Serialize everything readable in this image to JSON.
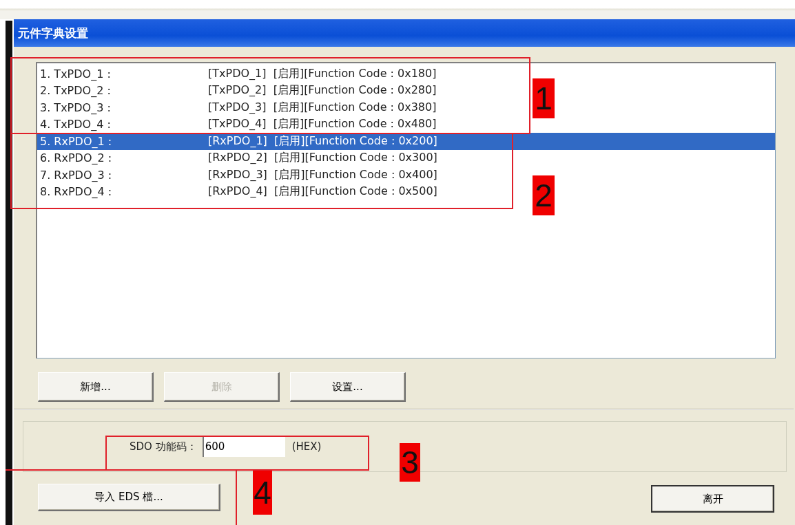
{
  "window": {
    "title": "元件字典设置"
  },
  "list": {
    "rows": [
      {
        "name": "1. TxPDO_1 :",
        "detail": "[TxPDO_1]  [启用][Function Code : 0x180]",
        "selected": false
      },
      {
        "name": "2. TxPDO_2 :",
        "detail": "[TxPDO_2]  [启用][Function Code : 0x280]",
        "selected": false
      },
      {
        "name": "3. TxPDO_3 :",
        "detail": "[TxPDO_3]  [启用][Function Code : 0x380]",
        "selected": false
      },
      {
        "name": "4. TxPDO_4 :",
        "detail": "[TxPDO_4]  [启用][Function Code : 0x480]",
        "selected": false
      },
      {
        "name": "5. RxPDO_1 :",
        "detail": "[RxPDO_1]  [启用][Function Code : 0x200]",
        "selected": true
      },
      {
        "name": "6. RxPDO_2 :",
        "detail": "[RxPDO_2]  [启用][Function Code : 0x300]",
        "selected": false
      },
      {
        "name": "7. RxPDO_3 :",
        "detail": "[RxPDO_3]  [启用][Function Code : 0x400]",
        "selected": false
      },
      {
        "name": "8. RxPDO_4 :",
        "detail": "[RxPDO_4]  [启用][Function Code : 0x500]",
        "selected": false
      }
    ]
  },
  "list_buttons": [
    {
      "label": "新增...",
      "disabled": false
    },
    {
      "label": "删除",
      "disabled": true
    },
    {
      "label": "设置..."
    }
  ],
  "sdo": {
    "label": "SDO 功能码：",
    "value": "600",
    "unit": "(HEX)"
  },
  "footer_buttons": [
    {
      "label": "导入 EDS 檔..."
    },
    {
      "label": "离开"
    }
  ],
  "annotations": [
    "1",
    "2",
    "3",
    "4"
  ]
}
